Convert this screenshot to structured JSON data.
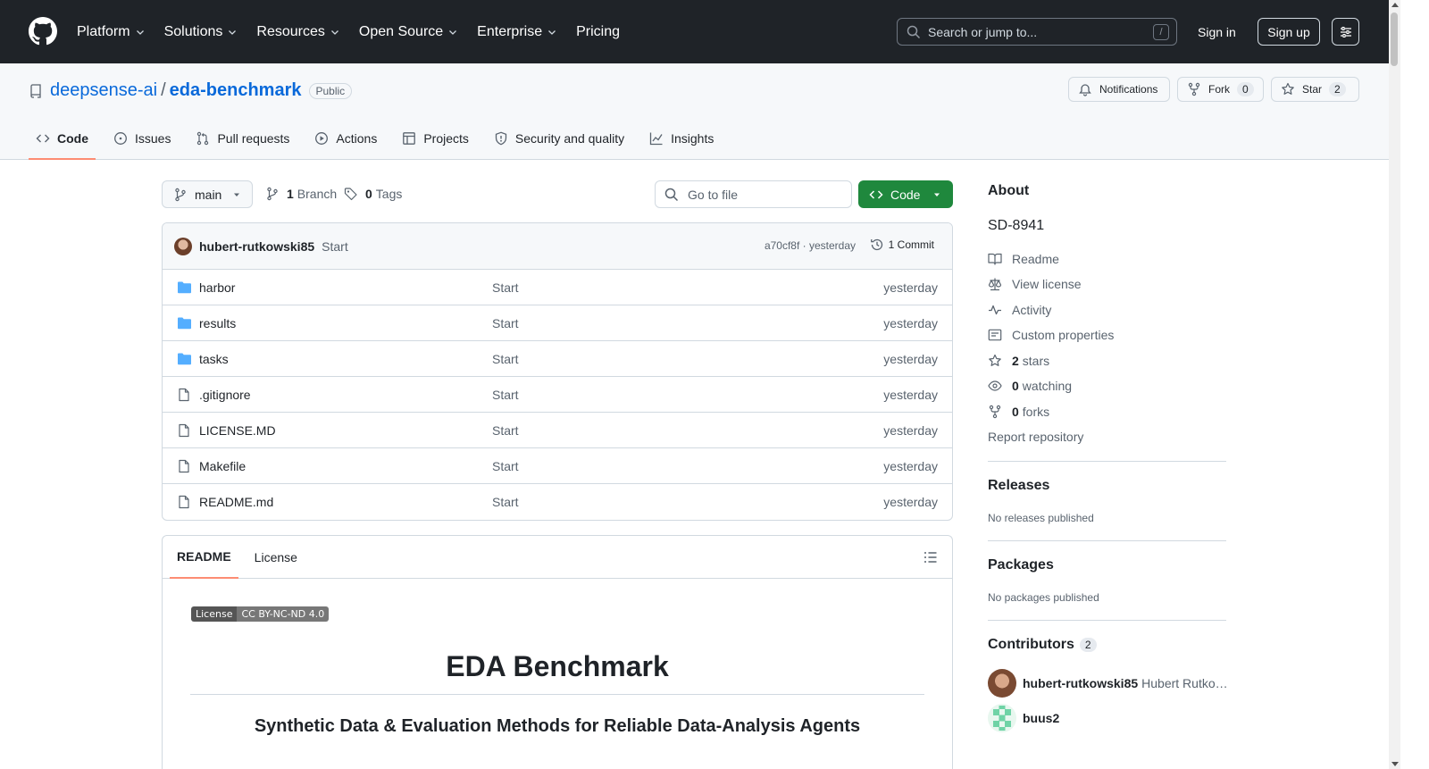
{
  "header": {
    "nav": [
      "Platform",
      "Solutions",
      "Resources",
      "Open Source",
      "Enterprise",
      "Pricing"
    ],
    "search_placeholder": "Search or jump to...",
    "search_shortcut": "/",
    "sign_in": "Sign in",
    "sign_up": "Sign up"
  },
  "repo": {
    "owner": "deepsense-ai",
    "separator": "/",
    "name": "eda-benchmark",
    "visibility": "Public",
    "notifications_label": "Notifications",
    "fork_label": "Fork",
    "fork_count": "0",
    "star_label": "Star",
    "star_count": "2",
    "tabs": [
      "Code",
      "Issues",
      "Pull requests",
      "Actions",
      "Projects",
      "Security and quality",
      "Insights"
    ]
  },
  "toolbar": {
    "branch": "main",
    "branches_count": "1",
    "branches_label": "Branch",
    "tags_count": "0",
    "tags_label": "Tags",
    "goto_placeholder": "Go to file",
    "code_button": "Code"
  },
  "commit": {
    "author": "hubert-rutkowski85",
    "message": "Start",
    "hash_time": "a70cf8f · yesterday",
    "count_label": "1 Commit"
  },
  "files": [
    {
      "name": "harbor",
      "type": "folder",
      "message": "Start",
      "date": "yesterday"
    },
    {
      "name": "results",
      "type": "folder",
      "message": "Start",
      "date": "yesterday"
    },
    {
      "name": "tasks",
      "type": "folder",
      "message": "Start",
      "date": "yesterday"
    },
    {
      "name": ".gitignore",
      "type": "file",
      "message": "Start",
      "date": "yesterday"
    },
    {
      "name": "LICENSE.MD",
      "type": "file",
      "message": "Start",
      "date": "yesterday"
    },
    {
      "name": "Makefile",
      "type": "file",
      "message": "Start",
      "date": "yesterday"
    },
    {
      "name": "README.md",
      "type": "file",
      "message": "Start",
      "date": "yesterday"
    }
  ],
  "readme": {
    "tab_readme": "README",
    "tab_license": "License",
    "badge_left": "License",
    "badge_right": "CC BY-NC-ND 4.0",
    "title": "EDA Benchmark",
    "subtitle": "Synthetic Data & Evaluation Methods for Reliable Data-Analysis Agents"
  },
  "sidebar": {
    "about_heading": "About",
    "description": "SD-8941",
    "readme_link": "Readme",
    "license_link": "View license",
    "activity_link": "Activity",
    "custom_props_link": "Custom properties",
    "stars_count": "2",
    "stars_label": "stars",
    "watching_count": "0",
    "watching_label": "watching",
    "forks_count": "0",
    "forks_label": "forks",
    "report": "Report repository",
    "releases_heading": "Releases",
    "releases_text": "No releases published",
    "packages_heading": "Packages",
    "packages_text": "No packages published",
    "contributors_heading": "Contributors",
    "contributors_count": "2",
    "contributors": [
      {
        "login": "hubert-rutkowski85",
        "full_name": "Hubert Rutko…"
      },
      {
        "login": "buus2",
        "full_name": ""
      }
    ]
  },
  "colors": {
    "header_bg": "#1f2328",
    "link": "#0969da",
    "primary_button": "#1f883d",
    "active_tab_underline": "#fd8c73",
    "folder_icon": "#54aeff"
  }
}
